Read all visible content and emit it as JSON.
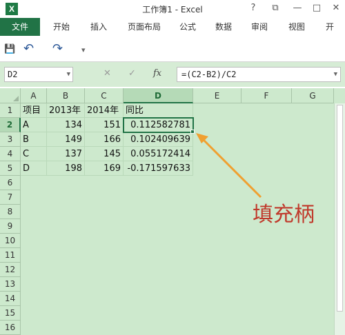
{
  "window": {
    "title": "工作簿1 - Excel",
    "logo": "X",
    "help": "?",
    "restore": "⧉",
    "minimize": "—",
    "maximize": "□",
    "close": "✕"
  },
  "ribbon": {
    "tabs": [
      "文件",
      "开始",
      "插入",
      "页面布局",
      "公式",
      "数据",
      "审阅",
      "视图",
      "开"
    ]
  },
  "qat": {
    "save": "💾",
    "undo": "↶",
    "redo": "↷",
    "customize": "▾"
  },
  "formula_bar": {
    "name_box": "D2",
    "cancel": "✕",
    "enter": "✓",
    "fx": "fx",
    "formula": "=(C2-B2)/C2"
  },
  "sheet": {
    "columns": [
      "A",
      "B",
      "C",
      "D",
      "E",
      "F",
      "G"
    ],
    "rows": [
      "1",
      "2",
      "3",
      "4",
      "5",
      "6",
      "7",
      "8",
      "9",
      "10",
      "11",
      "12",
      "13",
      "14",
      "15",
      "16"
    ],
    "active_cell": "D2",
    "header_row": [
      "项目",
      "2013年",
      "2014年",
      "同比"
    ],
    "data": [
      [
        "A",
        "134",
        "151",
        "0.112582781"
      ],
      [
        "B",
        "149",
        "166",
        "0.102409639"
      ],
      [
        "C",
        "137",
        "145",
        "0.055172414"
      ],
      [
        "D",
        "198",
        "169",
        "-0.171597633"
      ]
    ]
  },
  "annotation": {
    "text": "填充柄",
    "color": "#c0392b",
    "arrow_color": "#f0a030"
  },
  "colors": {
    "excel_green": "#217346",
    "grid_background": "#cde9cd"
  }
}
